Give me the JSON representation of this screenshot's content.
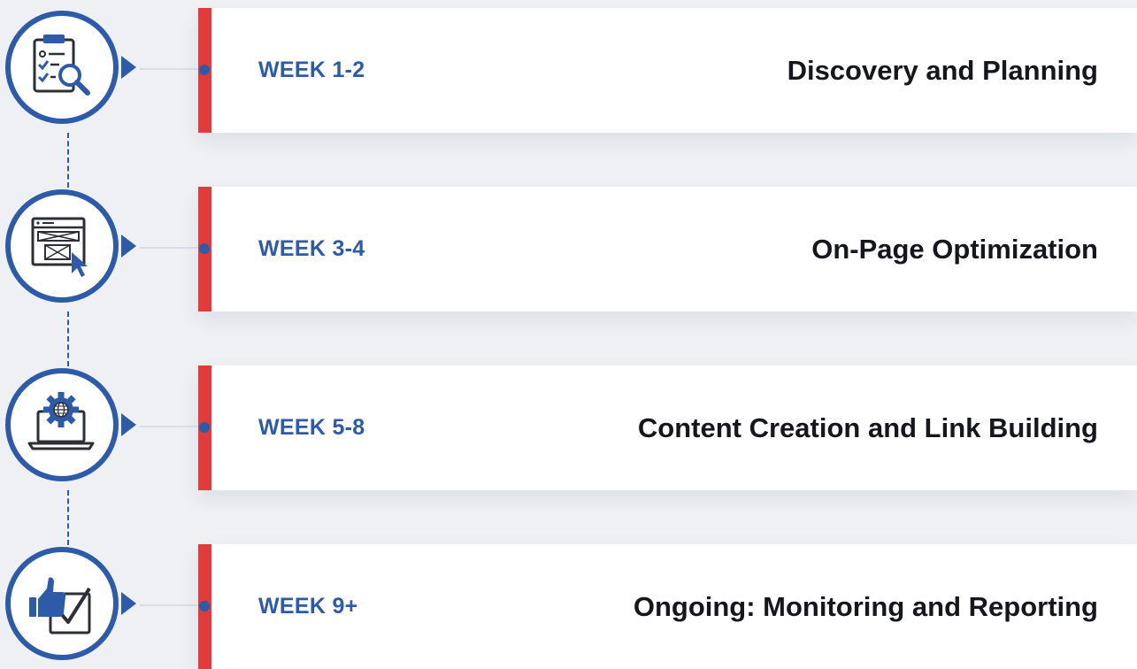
{
  "colors": {
    "background": "#eef0f4",
    "accent_blue": "#2d5aa9",
    "accent_red": "#e23b3b",
    "card": "#ffffff",
    "title_text": "#15171c"
  },
  "steps": [
    {
      "week": "WEEK 1-2",
      "title": "Discovery and Planning",
      "icon": "clipboard-search-icon"
    },
    {
      "week": "WEEK 3-4",
      "title": "On-Page Optimization",
      "icon": "webpage-cursor-icon"
    },
    {
      "week": "WEEK 5-8",
      "title": "Content Creation and Link Building",
      "icon": "laptop-gear-globe-icon"
    },
    {
      "week": "WEEK 9+",
      "title": "Ongoing: Monitoring and Reporting",
      "icon": "thumbs-up-checkbox-icon"
    }
  ]
}
